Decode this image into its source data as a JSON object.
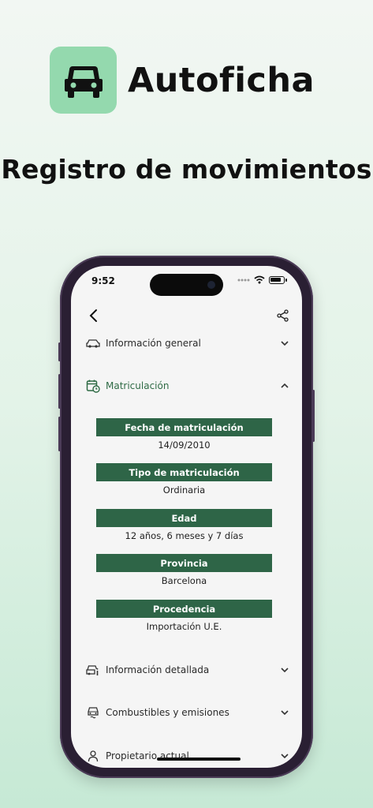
{
  "app": {
    "name": "Autoficha",
    "icon": "car-icon",
    "icon_bg": "#94d9ae"
  },
  "headline": "Registro de movimientos",
  "status_bar": {
    "time": "9:52"
  },
  "nav": {
    "back_icon": "chevron-left-icon",
    "share_icon": "share-icon"
  },
  "sections": {
    "general": {
      "label": "Información general",
      "icon": "car-icon"
    },
    "matriculacion": {
      "label": "Matriculación",
      "icon": "calendar-clock-icon"
    },
    "detallada": {
      "label": "Información detallada",
      "icon": "car-info-icon"
    },
    "combustibles": {
      "label": "Combustibles y emisiones",
      "icon": "car-emissions-icon"
    },
    "propietario": {
      "label": "Propietario actual",
      "icon": "person-icon"
    }
  },
  "fields": [
    {
      "title": "Fecha de matriculación",
      "value": "14/09/2010"
    },
    {
      "title": "Tipo de matriculación",
      "value": "Ordinaria"
    },
    {
      "title": "Edad",
      "value": "12 años, 6 meses y 7 días"
    },
    {
      "title": "Provincia",
      "value": "Barcelona"
    },
    {
      "title": "Procedencia",
      "value": "Importación U.E."
    }
  ],
  "colors": {
    "accent": "#2e6547",
    "accent_text": "#2f6b45",
    "screen_bg": "#f5f5f5"
  }
}
